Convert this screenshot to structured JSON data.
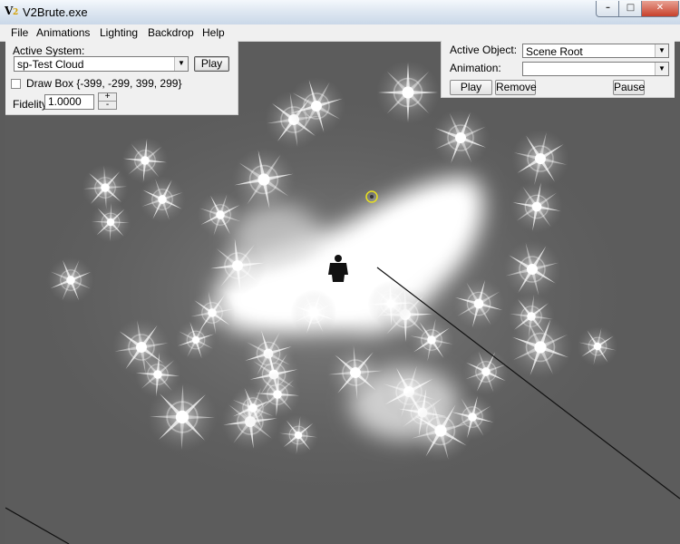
{
  "window": {
    "title": "V2Brute.exe",
    "controls": {
      "minimize": "–",
      "maximize": "□",
      "close": "✕"
    }
  },
  "menu": [
    "File",
    "Animations",
    "Lighting",
    "Backdrop",
    "Help"
  ],
  "left_panel": {
    "active_system_label": "Active System:",
    "active_system_value": "sp-Test Cloud",
    "play_label": "Play",
    "draw_box_label": "Draw Box {-399, -299, 399, 299}",
    "draw_box_checked": false,
    "fidelity_label": "Fidelity",
    "fidelity_value": "1.0000",
    "spin_up": "+",
    "spin_down": "-"
  },
  "right_panel": {
    "active_object_label": "Active Object:",
    "active_object_value": "Scene Root",
    "animation_label": "Animation:",
    "animation_value": "",
    "play_label": "Play",
    "remove_label": "Remove",
    "pause_label": "Pause"
  },
  "icons": {
    "dropdown": "chevron-down-icon",
    "app": "v2-app-icon",
    "target": "crosshair-target-icon",
    "figure": "character-silhouette-icon"
  },
  "colors": {
    "viewport_bg": "#5c5c5c",
    "particle": "#ffffff",
    "target_marker": "#e8e020"
  }
}
